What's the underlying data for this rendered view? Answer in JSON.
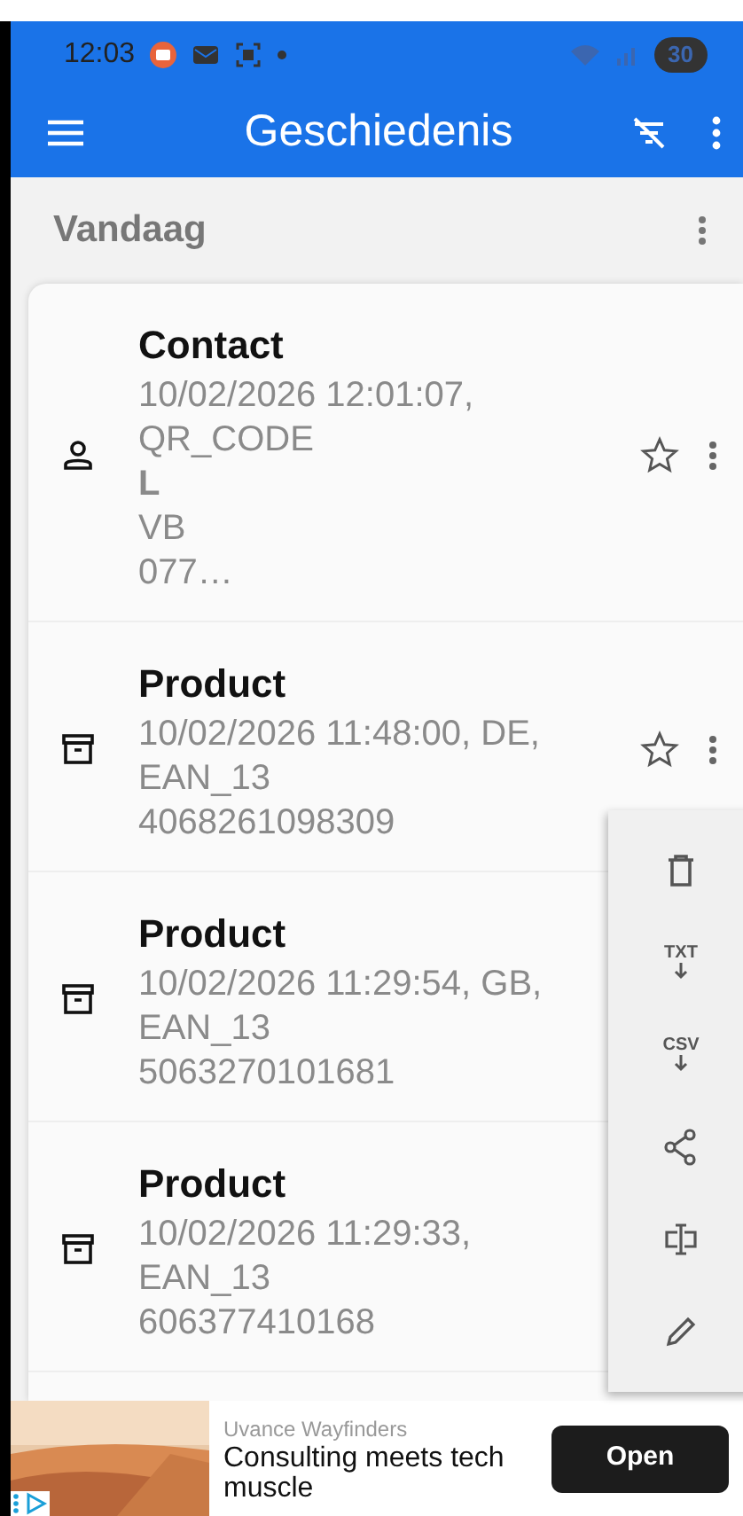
{
  "status_bar": {
    "time": "12:03",
    "battery": "30"
  },
  "app_bar": {
    "title": "Geschiedenis"
  },
  "section": {
    "title": "Vandaag"
  },
  "items": [
    {
      "kind": "contact",
      "title": "Contact",
      "lines": [
        "10/02/2026 12:01:07, QR_CODE"
      ],
      "extra": [
        "L",
        "VB",
        "077…"
      ],
      "favorite": false
    },
    {
      "kind": "product",
      "title": "Product",
      "lines": [
        "10/02/2026 11:48:00, DE, EAN_13",
        "4068261098309"
      ],
      "favorite": false
    },
    {
      "kind": "product",
      "title": "Product",
      "lines": [
        "10/02/2026 11:29:54, GB, EAN_13",
        "5063270101681"
      ]
    },
    {
      "kind": "product",
      "title": "Product",
      "lines": [
        "10/02/2026 11:29:33, EAN_13",
        "606377410168"
      ]
    }
  ],
  "menu": [
    {
      "kind": "delete"
    },
    {
      "kind": "export",
      "label": "TXT"
    },
    {
      "kind": "export",
      "label": "CSV"
    },
    {
      "kind": "share"
    },
    {
      "kind": "rename"
    },
    {
      "kind": "edit"
    }
  ],
  "ad": {
    "sponsor": "Uvance Wayfinders",
    "headline": "Consulting meets tech muscle",
    "button": "Open"
  }
}
